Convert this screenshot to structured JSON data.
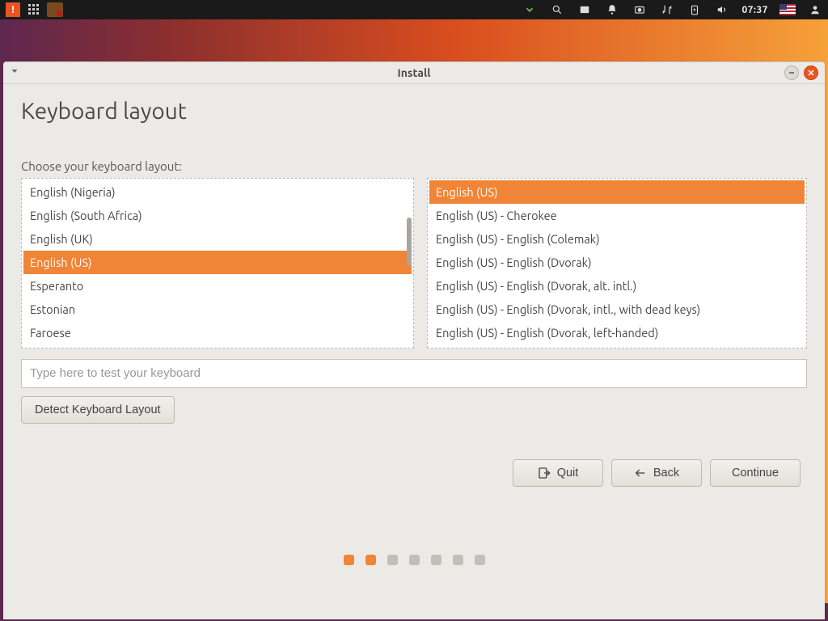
{
  "panel": {
    "time": "07:37"
  },
  "window": {
    "title": "Install"
  },
  "page": {
    "heading": "Keyboard layout",
    "instruction": "Choose your keyboard layout:",
    "test_placeholder": "Type here to test your keyboard",
    "detect_label": "Detect Keyboard Layout",
    "quit_label": "Quit",
    "back_label": "Back",
    "continue_label": "Continue"
  },
  "layouts_left": {
    "items": [
      "English (Nigeria)",
      "English (South Africa)",
      "English (UK)",
      "English (US)",
      "Esperanto",
      "Estonian",
      "Faroese"
    ],
    "selected_index": 3
  },
  "layouts_right": {
    "items": [
      "English (US)",
      "English (US) - Cherokee",
      "English (US) - English (Colemak)",
      "English (US) - English (Dvorak)",
      "English (US) - English (Dvorak, alt. intl.)",
      "English (US) - English (Dvorak, intl., with dead keys)",
      "English (US) - English (Dvorak, left-handed)"
    ],
    "selected_index": 0
  },
  "progress": {
    "total": 7,
    "active": [
      0,
      1
    ]
  }
}
